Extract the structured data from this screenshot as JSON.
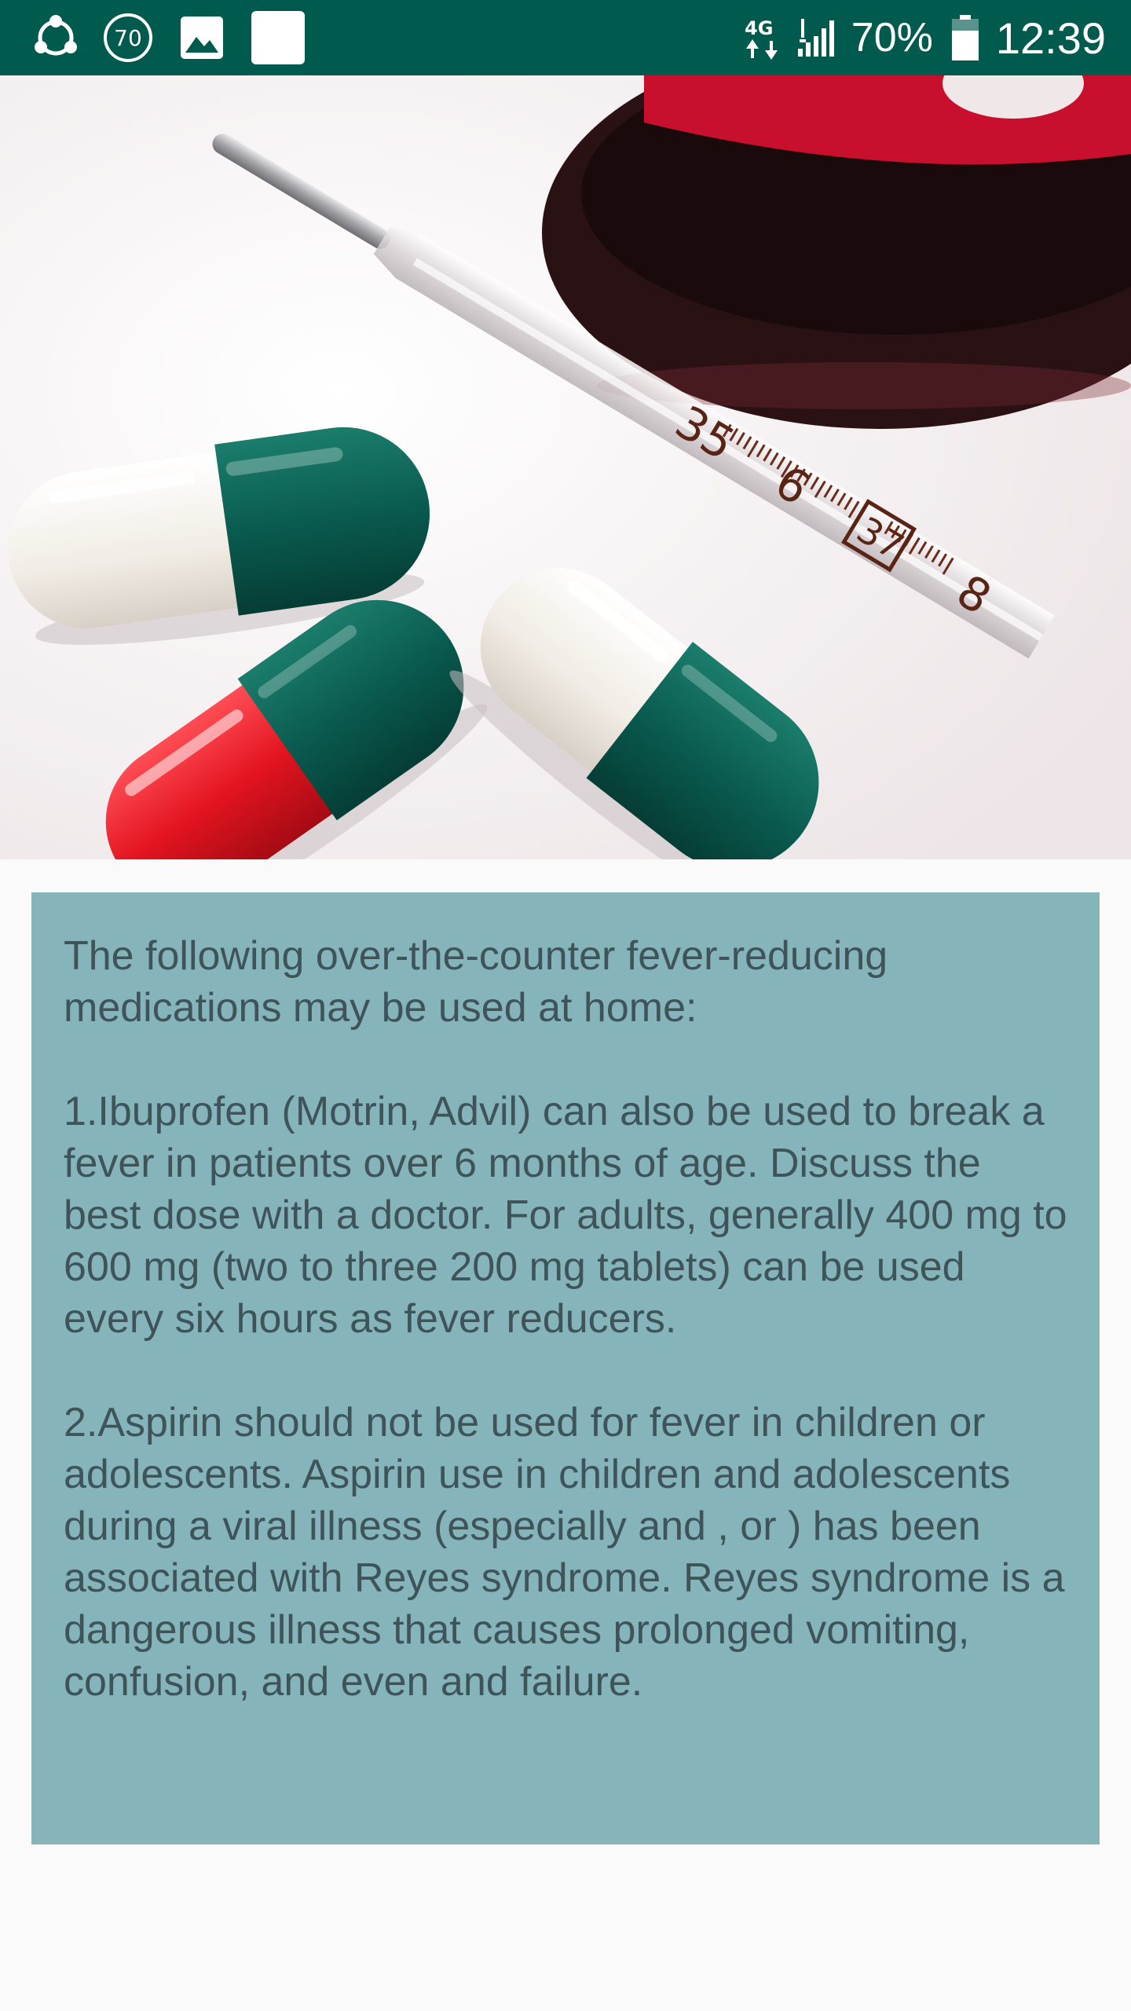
{
  "status_bar": {
    "notification_badge": "70",
    "battery_percent": "70%",
    "time": "12:39",
    "icons": [
      "share-icon",
      "badge-icon",
      "image-icon",
      "square-icon",
      "data-arrows-icon",
      "signal-icon",
      "battery-icon"
    ]
  },
  "hero": {
    "thermometer_marks": [
      "35",
      "6",
      "37",
      "8"
    ]
  },
  "content": {
    "intro": "The following over-the-counter fever-reducing medications may be used at home:",
    "item_1": "1.Ibuprofen (Motrin, Advil) can also be used to break a fever in patients over 6 months of age. Discuss the best dose with a doctor. For adults, generally 400 mg to 600 mg (two to three 200 mg tablets) can be used every six hours as fever reducers.",
    "item_2": "2.Aspirin should not be used for fever in children or adolescents. Aspirin use in children and adolescents during a viral illness (especially and , or ) has been associated with Reyes syndrome. Reyes syndrome is a dangerous illness that causes prolonged vomiting, confusion, and even and failure."
  },
  "colors": {
    "status_bar": "#005a4d",
    "card_background": "#85b4bb",
    "card_text": "#3e5459",
    "page_background": "#fafafa"
  }
}
